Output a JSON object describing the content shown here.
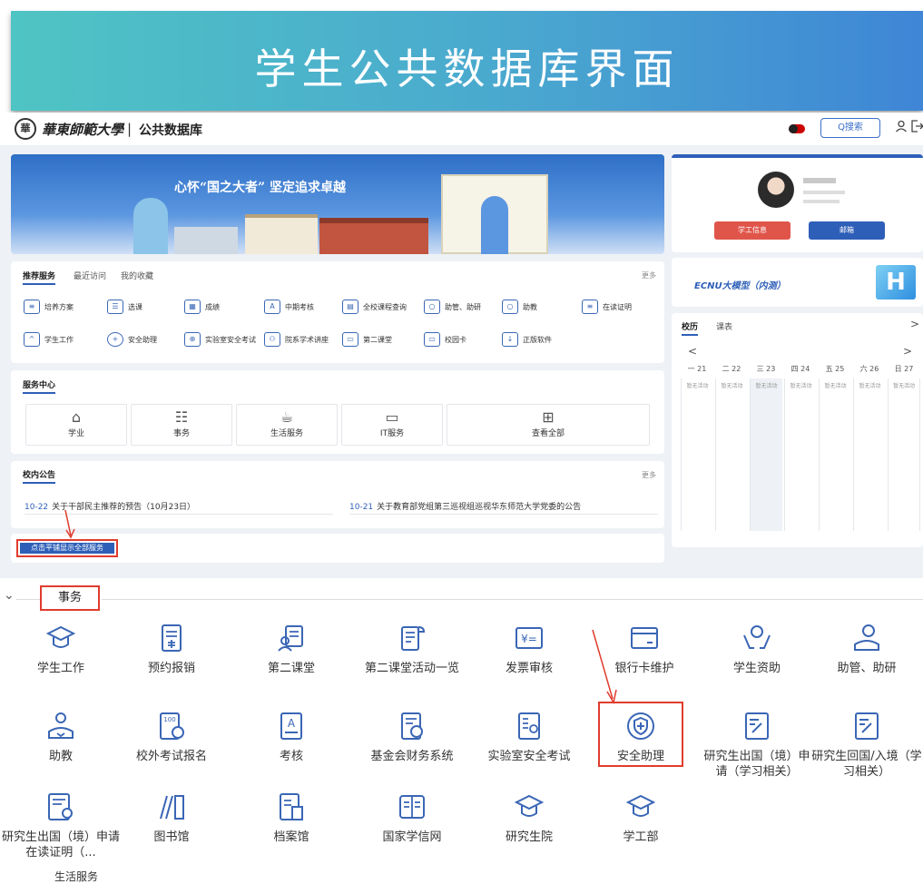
{
  "banner": {
    "title": "学生公共数据库界面"
  },
  "topnav": {
    "seal": "華",
    "logo_text": "華東師範大學",
    "separator": "|",
    "db_name": "公共数据库",
    "search": "Q搜索"
  },
  "hero": {
    "slogan": "心怀“国之大者” 坚定追求卓越"
  },
  "services": {
    "tabs": [
      "推荐服务",
      "最近访问",
      "我的收藏"
    ],
    "more": "更多",
    "row1": [
      "培养方案",
      "选课",
      "成绩",
      "中期考核",
      "全校课程查询",
      "助管、助研",
      "助教",
      "在读证明"
    ],
    "row2": [
      "学生工作",
      "安全助理",
      "实验室安全考试",
      "院系学术讲座",
      "第二课堂",
      "校园卡",
      "正版软件"
    ]
  },
  "service_center": {
    "title": "服务中心",
    "items": [
      "学业",
      "事务",
      "生活服务",
      "IT服务",
      "查看全部"
    ]
  },
  "notices": {
    "title": "校内公告",
    "more": "更多",
    "items": [
      {
        "date": "10-22",
        "text": "关于干部民主推荐的预告（10月23日）"
      },
      {
        "date": "10-21",
        "text": "关于教育部党组第三巡视组巡视华东师范大学党委的公告"
      }
    ]
  },
  "show_all_button": "点击平铺显示全部服务",
  "profile": {
    "btn_info": "学工信息",
    "btn_mail": "邮箱"
  },
  "model": {
    "label": "ECNU大模型（内测）"
  },
  "calendar": {
    "tabs": [
      "校历",
      "课表"
    ],
    "nav_prev": "<",
    "nav_next": ">",
    "days": [
      "一 21",
      "二 22",
      "三 23",
      "四 24",
      "五 25",
      "六 26",
      "日 27"
    ],
    "empty": "暂无活动"
  },
  "section": {
    "chevron": "⌄",
    "title": "事务",
    "row1": [
      "学生工作",
      "预约报销",
      "第二课堂",
      "第二课堂活动一览",
      "发票审核",
      "银行卡维护",
      "学生资助",
      "助管、助研"
    ],
    "row2": [
      "助教",
      "校外考试报名",
      "考核",
      "基金会财务系统",
      "实验室安全考试",
      "安全助理",
      "研究生出国（境）申请（学习相关）",
      "研究生回国/入境（学习相关）"
    ],
    "row3": [
      "研究生出国（境）申请在读证明（...",
      "图书馆",
      "档案馆",
      "国家学信网",
      "研究生院",
      "学工部"
    ],
    "next_section": "生活服务"
  },
  "colors": {
    "accent": "#2e5fb8",
    "highlight": "#e03c2d",
    "icon": "#3a66b5"
  }
}
